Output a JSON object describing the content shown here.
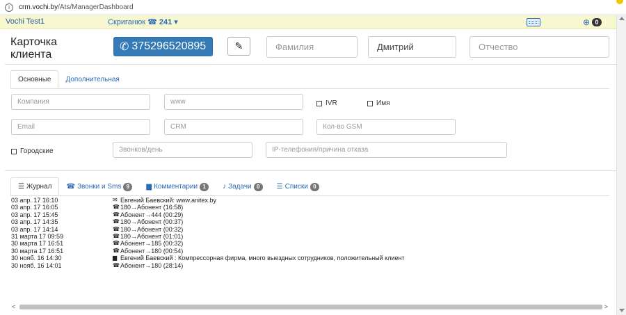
{
  "browser": {
    "url_host": "crm.vochi.by",
    "url_path": "/Ats/ManagerDashboard"
  },
  "topbar": {
    "company": "Vochi Test1",
    "user": "Скриганюк",
    "extension": "241",
    "notification_count": "0"
  },
  "card": {
    "title_line1": "Карточка",
    "title_line2": "клиента",
    "phone": "375296520895",
    "last_name_placeholder": "Фамилия",
    "first_name_value": "Дмитрий",
    "middle_name_placeholder": "Отчество"
  },
  "info_tabs": [
    {
      "label": "Основные",
      "active": true
    },
    {
      "label": "Дополнительная",
      "active": false
    }
  ],
  "fields": {
    "company_placeholder": "Компания",
    "www_placeholder": "www",
    "ivr_label": "IVR",
    "name_label": "Имя",
    "email_placeholder": "Email",
    "crm_placeholder": "CRM",
    "gsm_placeholder": "Кол-во GSM",
    "city_label": "Городские",
    "calls_per_day_placeholder": "Звонков/день",
    "ip_placeholder": "IP-телефония/причина отказа"
  },
  "activity_tabs": [
    {
      "label": "Журнал",
      "icon": "list-icon",
      "badge": "",
      "active": true
    },
    {
      "label": "Звонки и Sms",
      "icon": "phone-icon",
      "badge": "9",
      "active": false
    },
    {
      "label": "Комментарии",
      "icon": "comment-icon",
      "badge": "1",
      "active": false
    },
    {
      "label": "Задачи",
      "icon": "bell-icon",
      "badge": "0",
      "active": false
    },
    {
      "label": "Списки",
      "icon": "list-icon",
      "badge": "0",
      "active": false
    }
  ],
  "journal": [
    {
      "date": "03 апр. 17 16:10",
      "icon": "envelope-icon",
      "text": "Евгений Баевский: www.anitex.by"
    },
    {
      "date": "03 апр. 17 16:05",
      "icon": "phone-icon",
      "text": "180→Абонент (16:58)"
    },
    {
      "date": "03 апр. 17 15:45",
      "icon": "phone-icon",
      "text": "Абонент→444 (00:29)"
    },
    {
      "date": "03 апр. 17 14:35",
      "icon": "phone-icon",
      "text": "180→Абонент (00:37)"
    },
    {
      "date": "03 апр. 17 14:14",
      "icon": "phone-icon",
      "text": "180→Абонент (00:32)"
    },
    {
      "date": "31 марта 17 09:59",
      "icon": "phone-icon",
      "text": "180→Абонент (01:01)"
    },
    {
      "date": "30 марта 17 16:51",
      "icon": "phone-icon",
      "text": "Абонент→185 (00:32)"
    },
    {
      "date": "30 марта 17 16:51",
      "icon": "phone-icon",
      "text": "Абонент→180 (00:54)"
    },
    {
      "date": "30 нояб. 16 14:30",
      "icon": "comment-icon",
      "text": "Евгений Баевский : Компрессорная фирма, много выездных сотрудников, положительный клиент"
    },
    {
      "date": "30 нояб. 16 14:01",
      "icon": "phone-icon",
      "text": "Абонент→180 (28:14)"
    }
  ]
}
